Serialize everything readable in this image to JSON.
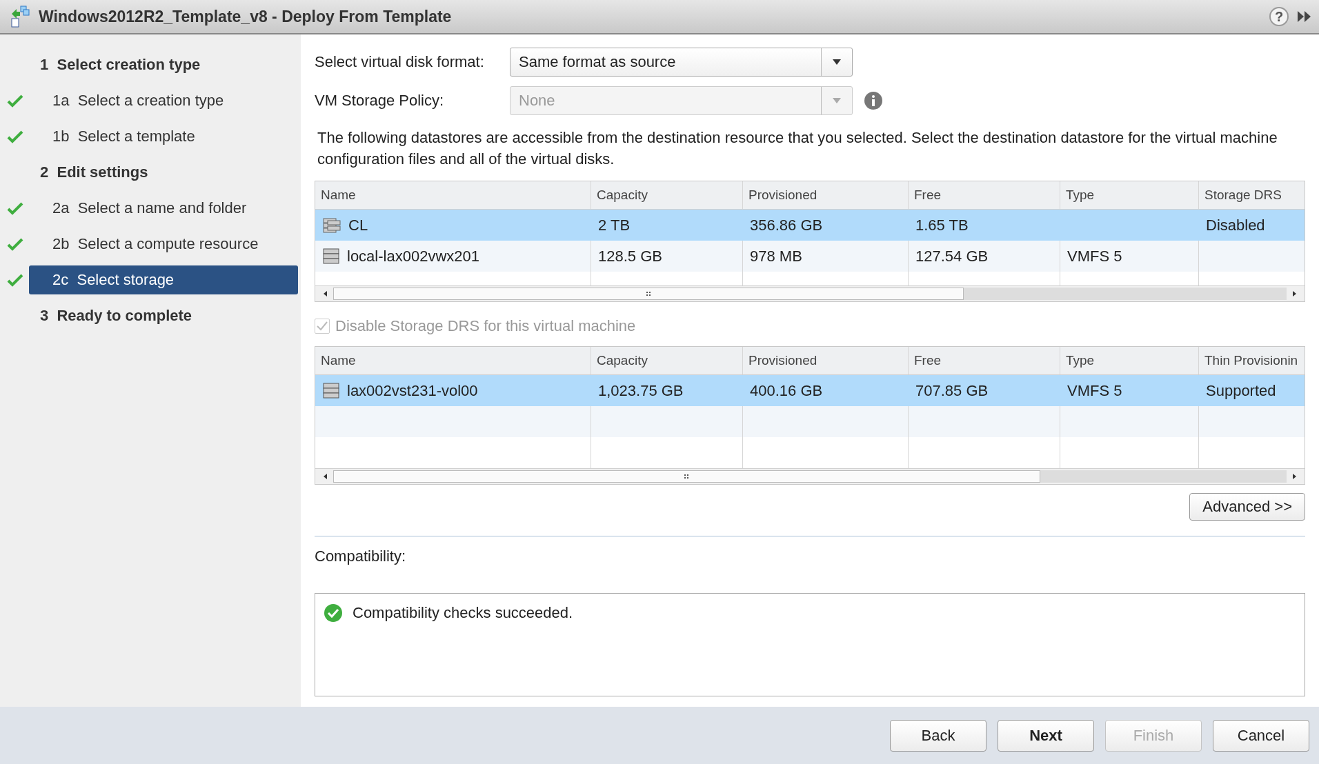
{
  "window": {
    "title": "Windows2012R2_Template_v8 - Deploy From Template",
    "help_glyph": "?"
  },
  "steps": [
    {
      "kind": "section",
      "number": "1",
      "label": "Select creation type"
    },
    {
      "kind": "step",
      "number": "1a",
      "label": "Select a creation type",
      "completed": true,
      "selected": false
    },
    {
      "kind": "step",
      "number": "1b",
      "label": "Select a template",
      "completed": true,
      "selected": false
    },
    {
      "kind": "section",
      "number": "2",
      "label": "Edit settings"
    },
    {
      "kind": "step",
      "number": "2a",
      "label": "Select a name and folder",
      "completed": true,
      "selected": false
    },
    {
      "kind": "step",
      "number": "2b",
      "label": "Select a compute resource",
      "completed": true,
      "selected": false
    },
    {
      "kind": "step",
      "number": "2c",
      "label": "Select storage",
      "completed": true,
      "selected": true
    },
    {
      "kind": "section",
      "number": "3",
      "label": "Ready to complete"
    }
  ],
  "disk_format": {
    "label": "Select virtual disk format:",
    "value": "Same format as source",
    "disabled": false
  },
  "storage_policy": {
    "label": "VM Storage Policy:",
    "value": "None",
    "disabled": true
  },
  "description": "The following datastores are accessible from the destination resource that you selected. Select the destination datastore for the virtual machine configuration files and all of the virtual disks.",
  "datastores": {
    "columns": [
      "Name",
      "Capacity",
      "Provisioned",
      "Free",
      "Type",
      "Storage DRS"
    ],
    "rows": [
      {
        "kind": "cluster",
        "selected": true,
        "cells": [
          "CL",
          "2 TB",
          "356.86 GB",
          "1.65 TB",
          "",
          "Disabled"
        ]
      },
      {
        "kind": "datastore",
        "selected": false,
        "cells": [
          "local-lax002vwx201",
          "128.5 GB",
          "978 MB",
          "127.54 GB",
          "VMFS 5",
          ""
        ]
      }
    ]
  },
  "disable_sdrs": {
    "label": "Disable Storage DRS for this virtual machine",
    "checked": true,
    "disabled": true
  },
  "storage_table": {
    "columns": [
      "Name",
      "Capacity",
      "Provisioned",
      "Free",
      "Type",
      "Thin Provisionin"
    ],
    "rows": [
      {
        "kind": "datastore",
        "selected": true,
        "cells": [
          "lax002vst231-vol00",
          "1,023.75 GB",
          "400.16 GB",
          "707.85 GB",
          "VMFS 5",
          "Supported"
        ]
      }
    ]
  },
  "advanced_button": "Advanced >>",
  "compatibility": {
    "label": "Compatibility:",
    "message": "Compatibility checks succeeded."
  },
  "buttons": [
    {
      "label": "Back",
      "disabled": false,
      "primary": false
    },
    {
      "label": "Next",
      "disabled": false,
      "primary": true
    },
    {
      "label": "Finish",
      "disabled": true,
      "primary": false
    },
    {
      "label": "Cancel",
      "disabled": false,
      "primary": false
    }
  ]
}
